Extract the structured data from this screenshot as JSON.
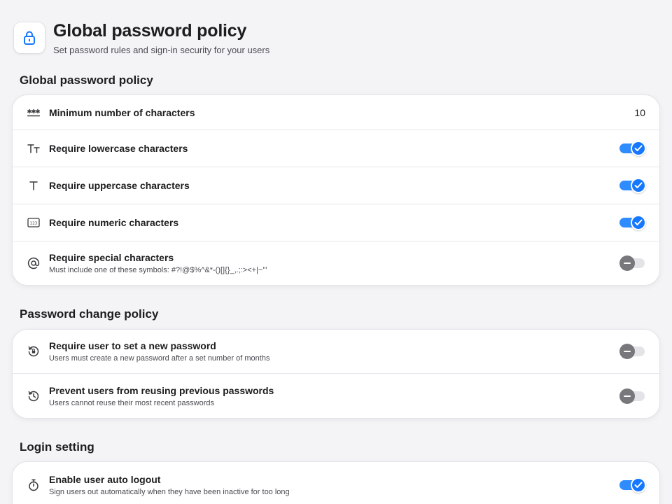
{
  "header": {
    "title": "Global password policy",
    "subtitle": "Set password rules and sign-in security for your users",
    "icon": "lock-icon"
  },
  "sections": [
    {
      "title": "Global password policy",
      "rows": [
        {
          "icon": "asterisks-icon",
          "label": "Minimum number of characters",
          "value": "10"
        },
        {
          "icon": "text-case-icon",
          "label": "Require lowercase characters",
          "toggle": true
        },
        {
          "icon": "uppercase-t-icon",
          "label": "Require uppercase characters",
          "toggle": true
        },
        {
          "icon": "numeric-123-icon",
          "label": "Require numeric characters",
          "toggle": true
        },
        {
          "icon": "at-sign-icon",
          "label": "Require special characters",
          "desc": "Must include one of these symbols: #?!@$%^&*-()[]{}_,.;:><+|~'\"",
          "toggle": false
        }
      ]
    },
    {
      "title": "Password change policy",
      "rows": [
        {
          "icon": "lock-refresh-icon",
          "label": "Require user to set a new password",
          "desc": "Users must create a new password after a set number of months",
          "toggle": false
        },
        {
          "icon": "history-icon",
          "label": "Prevent users from reusing previous passwords",
          "desc": "Users cannot reuse their most recent passwords",
          "toggle": false
        }
      ]
    },
    {
      "title": "Login setting",
      "rows": [
        {
          "icon": "stopwatch-icon",
          "label": "Enable user auto logout",
          "desc": "Sign users out automatically when they have been inactive for too long",
          "toggle": true
        }
      ]
    }
  ],
  "colors": {
    "accent": "#1677ff",
    "toggle_track_on": "#2f8cff",
    "toggle_off_knob": "#77777c",
    "background": "#f4f4f7"
  }
}
